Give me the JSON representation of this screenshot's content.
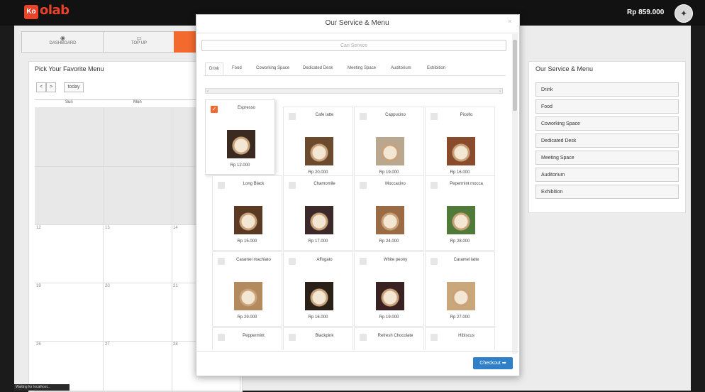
{
  "header": {
    "logo_mark": "Ko",
    "logo_text": "olab",
    "balance": "Rp 859.000",
    "avatar_icon": "logo-icon"
  },
  "nav": {
    "tabs": [
      {
        "label": "DASHBOARD",
        "icon": "dashboard-icon"
      },
      {
        "label": "TOP UP",
        "icon": "wallet-icon"
      }
    ]
  },
  "calendar": {
    "title": "Pick Your Favorite Menu",
    "prev": "<",
    "next": ">",
    "today": "today",
    "days": [
      "Sun",
      "Mon"
    ],
    "week_numbers": [
      "12",
      "13",
      "14",
      "19",
      "20",
      "21",
      "26",
      "27",
      "28"
    ]
  },
  "right_panel": {
    "title": "Our Service & Menu",
    "items": [
      "Drink",
      "Food",
      "Coworking Space",
      "Dedicated Desk",
      "Meeting Space",
      "Auditorium",
      "Exhibition"
    ]
  },
  "modal": {
    "title": "Our Service & Menu",
    "close": "×",
    "search_placeholder": "Cari Service",
    "tabs": [
      "Drink",
      "Food",
      "Coworking Space",
      "Dedicated Desk",
      "Meeting Space",
      "Auditorium",
      "Exhibition"
    ],
    "scroll_left": "‹",
    "scroll_right": "›",
    "items": [
      {
        "name": "Espresso",
        "price": "Rp 12.000",
        "selected": true,
        "color": "#3a2a20"
      },
      {
        "name": "Cafe latte",
        "price": "Rp 20.000",
        "selected": false,
        "color": "#6b4a2e"
      },
      {
        "name": "Cappucino",
        "price": "Rp 19.000",
        "selected": false,
        "color": "#b9a88f"
      },
      {
        "name": "Picollo",
        "price": "Rp 16.000",
        "selected": false,
        "color": "#8a4b2c"
      },
      {
        "name": "Long Black",
        "price": "Rp 15.000",
        "selected": false,
        "color": "#5a3a22"
      },
      {
        "name": "Chamomile",
        "price": "Rp 17.000",
        "selected": false,
        "color": "#3c2a2a"
      },
      {
        "name": "Moccacino",
        "price": "Rp 24.000",
        "selected": false,
        "color": "#9a6b44"
      },
      {
        "name": "Pepermint mocca",
        "price": "Rp 28.000",
        "selected": false,
        "color": "#4f7a3a"
      },
      {
        "name": "Caramel machiato",
        "price": "Rp 29.000",
        "selected": false,
        "color": "#b38a5e"
      },
      {
        "name": "Affogato",
        "price": "Rp 16.000",
        "selected": false,
        "color": "#2a2018"
      },
      {
        "name": "White peony",
        "price": "Rp 19.000",
        "selected": false,
        "color": "#3a2222"
      },
      {
        "name": "Caramel latte",
        "price": "Rp 27.000",
        "selected": false,
        "color": "#c9a77a"
      },
      {
        "name": "Peppermint",
        "price": "",
        "selected": false,
        "color": "#ffffff"
      },
      {
        "name": "Blackpink",
        "price": "",
        "selected": false,
        "color": "#ffffff"
      },
      {
        "name": "Refresh Chocolate",
        "price": "",
        "selected": false,
        "color": "#ffffff"
      },
      {
        "name": "Hibiscus",
        "price": "",
        "selected": false,
        "color": "#ffffff"
      }
    ],
    "checkout_label": "Checkout ➡"
  },
  "status_bar": "Waiting for localhost..."
}
